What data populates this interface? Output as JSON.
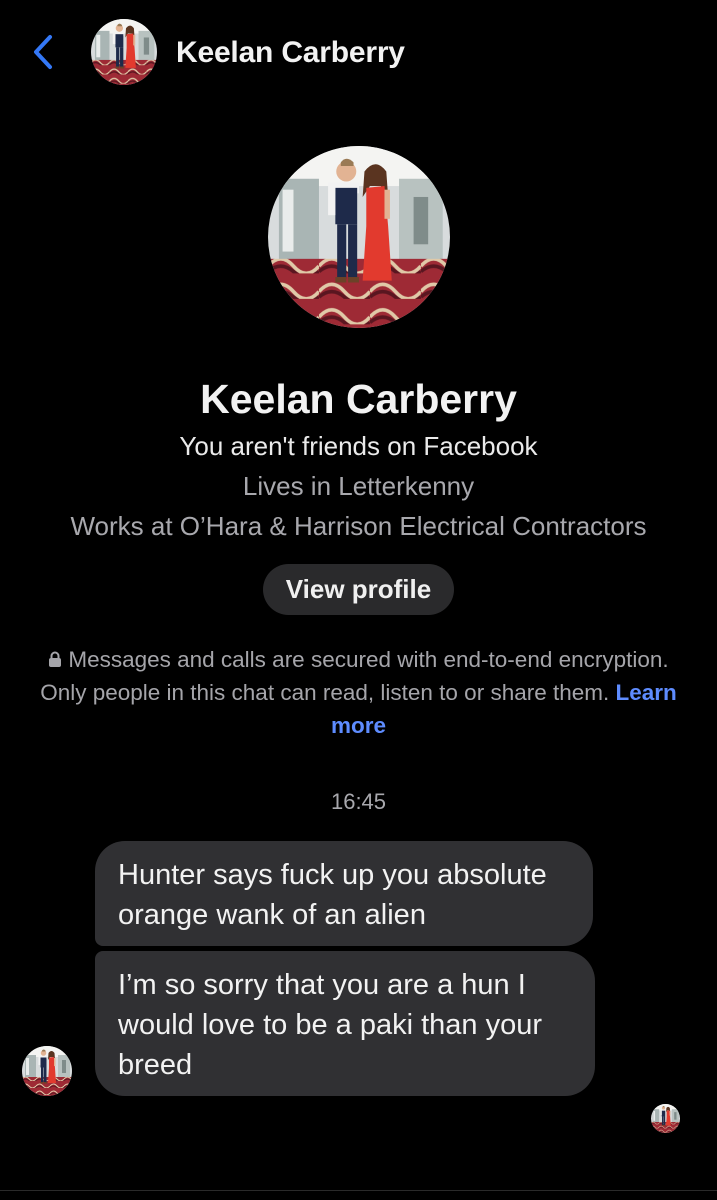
{
  "header": {
    "back_icon": "chevron-left-icon",
    "title": "Keelan Carberry",
    "accent_color": "#3478f6"
  },
  "profile": {
    "name": "Keelan Carberry",
    "relationship": "You aren't friends on Facebook",
    "lives": "Lives in Letterkenny",
    "works": "Works at O’Hara & Harrison Electrical Contractors",
    "view_profile_label": "View profile"
  },
  "encryption": {
    "icon": "lock-icon",
    "text": "Messages and calls are secured with end-to-end encryption. Only people in this chat can read, listen to or share them.",
    "link_label": "Learn more",
    "link_color": "#5e8cff"
  },
  "conversation": {
    "timestamp": "16:45",
    "messages": [
      {
        "text": "Hunter says fuck up you absolute orange wank of an alien"
      },
      {
        "text": "I’m so sorry that you are a hun I would love to be a paki than your breed"
      }
    ]
  }
}
